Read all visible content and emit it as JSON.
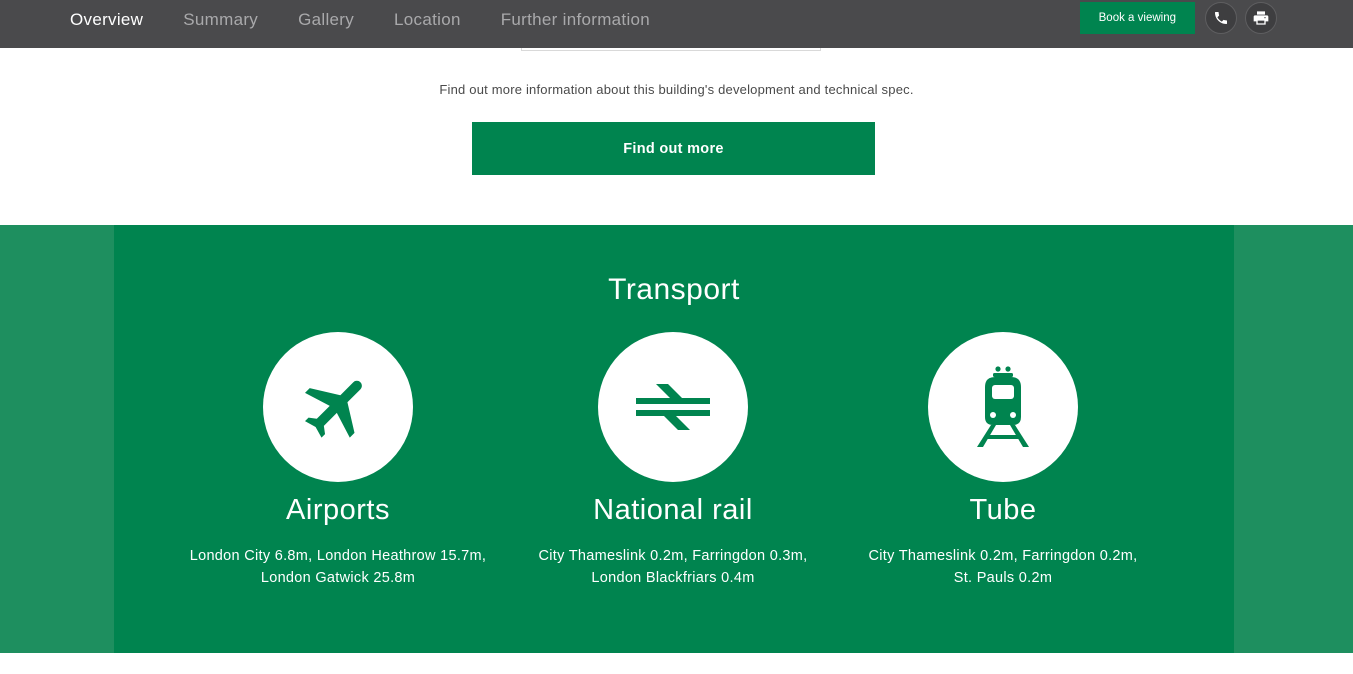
{
  "nav": {
    "tabs": [
      {
        "label": "Overview",
        "active": true
      },
      {
        "label": "Summary",
        "active": false
      },
      {
        "label": "Gallery",
        "active": false
      },
      {
        "label": "Location",
        "active": false
      },
      {
        "label": "Further information",
        "active": false
      }
    ],
    "book_label": "Book a viewing",
    "icons": [
      "phone-icon",
      "print-icon"
    ]
  },
  "info": {
    "text": "Find out more information about this building's development and technical spec.",
    "button_label": "Find out more"
  },
  "transport": {
    "title": "Transport",
    "modes": [
      {
        "icon": "airplane-icon",
        "title": "Airports",
        "line1": "London City 6.8m, London Heathrow 15.7m,",
        "line2": "London Gatwick 25.8m"
      },
      {
        "icon": "national-rail-icon",
        "title": "National rail",
        "line1": "City Thameslink 0.2m, Farringdon 0.3m,",
        "line2": "London Blackfriars 0.4m"
      },
      {
        "icon": "train-icon",
        "title": "Tube",
        "line1": "City Thameslink 0.2m, Farringdon 0.2m,",
        "line2": "St. Pauls 0.2m"
      }
    ]
  },
  "colors": {
    "nav_bg": "#4a4a4c",
    "brand_green": "#00844f",
    "band_green": "#1e8f5f"
  }
}
